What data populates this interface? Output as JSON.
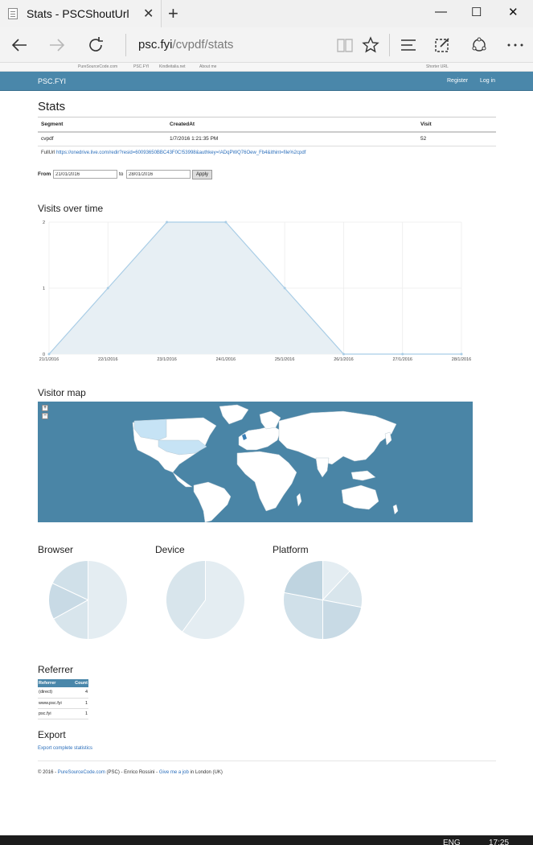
{
  "browser": {
    "tab_title": "Stats - PSCShoutUrl",
    "url_host": "psc.fyi",
    "url_path": "/cvpdf/stats",
    "minimize": "—",
    "maximize": "☐",
    "close": "✕",
    "new_tab": "+",
    "tab_close": "✕"
  },
  "top_links": {
    "items": [
      "PureSourceCode.com",
      "PSC.FYI",
      "Kindleitalia.net",
      "About me"
    ],
    "right": "Shorter URL"
  },
  "header": {
    "brand": "PSC.FYI",
    "register": "Register",
    "login": "Log in"
  },
  "stats": {
    "title": "Stats",
    "columns": [
      "Segment",
      "CreatedAt",
      "Visit"
    ],
    "row": [
      "cvpdf",
      "1/7/2016 1:21:35 PM",
      "52"
    ],
    "full_url_label": "FullUrl",
    "full_url": "https://onedrive.live.com/redir?resid=60093650BBC43F0C!53998&authkey=!ADqPWQ76Oew_Fb4&ithint=file%2cpdf"
  },
  "filter": {
    "from_label": "From",
    "from_value": "21/01/2016",
    "to_label": "to",
    "to_value": "28/01/2016",
    "apply_label": "Apply"
  },
  "visits": {
    "title": "Visits over time"
  },
  "chart_data": {
    "type": "area",
    "title": "Visits over time",
    "categories": [
      "21/1/2016",
      "22/1/2016",
      "23/1/2016",
      "24/1/2016",
      "25/1/2016",
      "26/1/2016",
      "27/1/2016",
      "28/1/2016"
    ],
    "values": [
      0,
      1,
      2,
      2,
      1,
      0,
      0,
      0
    ],
    "ylim": [
      0,
      2
    ],
    "yticks": [
      "0",
      "1",
      "2"
    ],
    "grid": true,
    "line_color": "#a9cde6",
    "fill_color": "#e7eff4"
  },
  "map": {
    "title": "Visitor map",
    "zoom_in": "+",
    "zoom_out": "−",
    "sea_color": "#4a85a6",
    "land_color": "#ffffff",
    "highlight_color": "#c6e3f5"
  },
  "pies": [
    {
      "title": "Browser",
      "values": [
        0.5,
        0.17,
        0.15,
        0.18
      ]
    },
    {
      "title": "Device",
      "values": [
        0.6,
        0.4
      ]
    },
    {
      "title": "Platform",
      "values": [
        0.12,
        0.16,
        0.22,
        0.28,
        0.22
      ]
    }
  ],
  "referrer": {
    "title": "Referrer",
    "columns": [
      "Referrer",
      "Count"
    ],
    "rows": [
      [
        "(direct)",
        "4"
      ],
      [
        "www.psc.fyi",
        "1"
      ],
      [
        "psc.fyi",
        "1"
      ]
    ]
  },
  "export": {
    "title": "Export",
    "link": "Export complete statistics"
  },
  "footer": {
    "prefix": "© 2016 - ",
    "site": "PureSourceCode.com",
    "middle": " (PSC) - Enrico Rossini - ",
    "job": "Give me a job",
    "suffix": " in London (UK)"
  },
  "taskbar": {
    "lang": "ENG",
    "time": "17:25"
  }
}
